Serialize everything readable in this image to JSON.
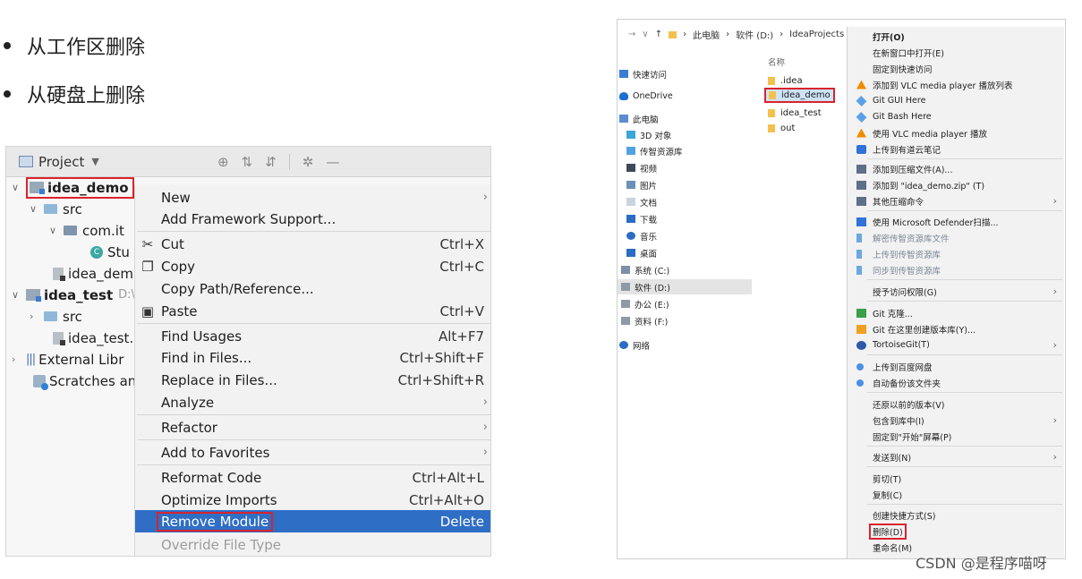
{
  "bullets": [
    "从工作区删除",
    "从硬盘上删除"
  ],
  "ide": {
    "toolbar_title": "Project",
    "tree": {
      "idea_demo": "idea_demo",
      "src": "src",
      "com_it": "com.it",
      "stu": "Stu",
      "idea_dem_file": "idea_dem",
      "idea_test": "idea_test",
      "idea_test_path": "D:\\",
      "src2": "src",
      "idea_test_file": "idea_test.",
      "external": "External Libr",
      "scratches": "Scratches an"
    },
    "menu": [
      {
        "label": "New",
        "shortcut": "",
        "submenu": true
      },
      {
        "label": "Add Framework Support...",
        "shortcut": ""
      },
      {
        "label": "Cut",
        "shortcut": "Ctrl+X",
        "icon": "cut-icon"
      },
      {
        "label": "Copy",
        "shortcut": "Ctrl+C",
        "icon": "copy-icon"
      },
      {
        "label": "Copy Path/Reference...",
        "shortcut": ""
      },
      {
        "label": "Paste",
        "shortcut": "Ctrl+V",
        "icon": "paste-icon"
      },
      {
        "label": "Find Usages",
        "shortcut": "Alt+F7"
      },
      {
        "label": "Find in Files...",
        "shortcut": "Ctrl+Shift+F"
      },
      {
        "label": "Replace in Files...",
        "shortcut": "Ctrl+Shift+R"
      },
      {
        "label": "Analyze",
        "shortcut": "",
        "submenu": true
      },
      {
        "label": "Refactor",
        "shortcut": "",
        "submenu": true
      },
      {
        "label": "Add to Favorites",
        "shortcut": "",
        "submenu": true
      },
      {
        "label": "Reformat Code",
        "shortcut": "Ctrl+Alt+L"
      },
      {
        "label": "Optimize Imports",
        "shortcut": "Ctrl+Alt+O"
      },
      {
        "label": "Remove Module",
        "shortcut": "Delete",
        "selected": true
      },
      {
        "label": "Override File Type",
        "shortcut": "",
        "disabled": true
      }
    ]
  },
  "explorer": {
    "address": [
      "此电脑",
      "软件 (D:)",
      "IdeaProjects"
    ],
    "nav": [
      "快速访问",
      "OneDrive",
      "此电脑",
      "3D 对象",
      "传智资源库",
      "视频",
      "图片",
      "文档",
      "下载",
      "音乐",
      "桌面",
      "系统 (C:)",
      "软件 (D:)",
      "办公 (E:)",
      "资料 (F:)",
      "网络"
    ],
    "column_name": "名称",
    "files": [
      ".idea",
      "idea_demo",
      "idea_test",
      "out"
    ],
    "menu": [
      {
        "label": "打开(O)",
        "bold": true
      },
      {
        "label": "在新窗口中打开(E)"
      },
      {
        "label": "固定到快速访问"
      },
      {
        "label": "添加到 VLC media player 播放列表",
        "icon": "vlc-icon"
      },
      {
        "label": "Git GUI Here",
        "icon": "git-icon"
      },
      {
        "label": "Git Bash Here",
        "icon": "git-icon"
      },
      {
        "label": "使用 VLC media player 播放",
        "icon": "vlc-icon"
      },
      {
        "label": "上传到有道云笔记",
        "icon": "note-icon"
      },
      {
        "label": "添加到压缩文件(A)...",
        "icon": "zip-icon"
      },
      {
        "label": "添加到 \"idea_demo.zip\" (T)",
        "icon": "zip-icon"
      },
      {
        "label": "其他压缩命令",
        "icon": "zip-icon",
        "submenu": true
      },
      {
        "label": "使用 Microsoft Defender扫描...",
        "icon": "shield-icon"
      },
      {
        "label": "解密传智资源库文件",
        "dim": true
      },
      {
        "label": "上传到传智资源库",
        "dim": true
      },
      {
        "label": "同步到传智资源库",
        "dim": true
      },
      {
        "label": "授予访问权限(G)",
        "submenu": true
      },
      {
        "label": "Git 克隆...",
        "icon": "git-icon"
      },
      {
        "label": "Git 在这里创建版本库(Y)...",
        "icon": "git-icon"
      },
      {
        "label": "TortoiseGit(T)",
        "icon": "tortoise-icon",
        "submenu": true
      },
      {
        "label": "上传到百度网盘",
        "icon": "cloud-icon"
      },
      {
        "label": "自动备份该文件夹",
        "icon": "cloud-icon"
      },
      {
        "label": "还原以前的版本(V)"
      },
      {
        "label": "包含到库中(I)",
        "submenu": true
      },
      {
        "label": "固定到\"开始\"屏幕(P)"
      },
      {
        "label": "发送到(N)",
        "submenu": true
      },
      {
        "label": "剪切(T)"
      },
      {
        "label": "复制(C)"
      },
      {
        "label": "创建快捷方式(S)"
      },
      {
        "label": "删除(D)",
        "boxed": true
      },
      {
        "label": "重命名(M)"
      }
    ]
  },
  "watermark": "CSDN @是程序喵呀",
  "colors": {
    "selection": "#2f6ec5",
    "highlight_box": "#d9232d"
  }
}
